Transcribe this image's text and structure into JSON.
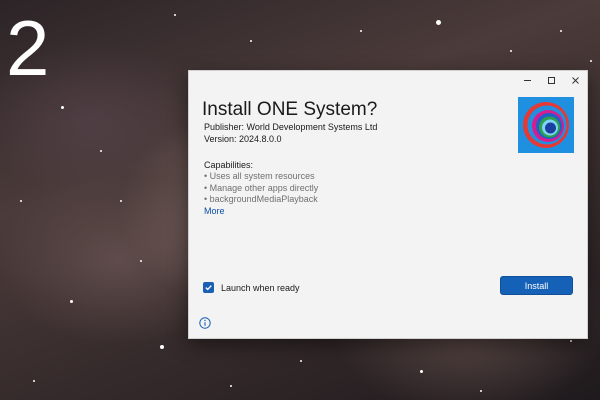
{
  "background": {
    "step_number": "2"
  },
  "window_controls": {
    "minimize_icon": "minimize-icon",
    "maximize_icon": "maximize-icon",
    "close_icon": "close-icon"
  },
  "dialog": {
    "title": "Install ONE System?",
    "publisher": "Publisher: World Development Systems Ltd",
    "version": "Version: 2024.8.0.0",
    "capabilities_heading": "Capabilities:",
    "capabilities": [
      "• Uses all system resources",
      "• Manage other apps directly",
      "• backgroundMediaPlayback"
    ],
    "more_link": "More",
    "launch_when_ready": {
      "label": "Launch when ready",
      "checked": true
    },
    "install_button": "Install",
    "logo_icon": "app-logo-icon",
    "info_icon": "info-icon"
  },
  "colors": {
    "accent": "#1561b8",
    "link": "#0b4fa8",
    "dialog_bg": "#f3f3f3",
    "logo_tile": "#1f8fe0"
  }
}
